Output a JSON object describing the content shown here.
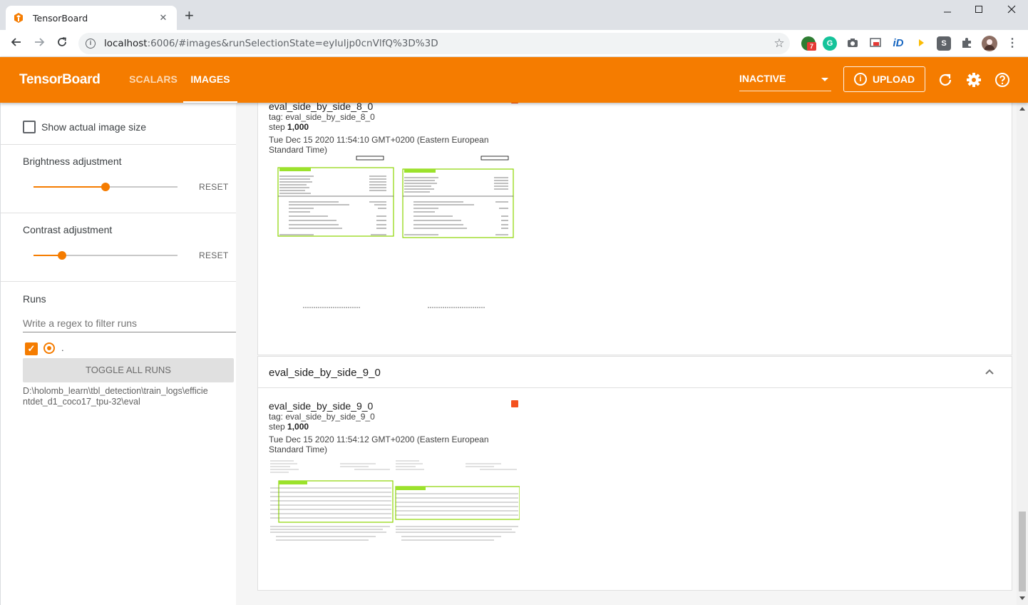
{
  "browser": {
    "tab_title": "TensorBoard",
    "close_glyph": "✕",
    "new_tab_glyph": "+",
    "url_host": "localhost",
    "url_rest": ":6006/#images&runSelectionState=eyIuIjp0cnVlfQ%3D%3D",
    "extension_badge": "7"
  },
  "header": {
    "brand": "TensorBoard",
    "tabs": [
      "SCALARS",
      "IMAGES"
    ],
    "active_tab": "IMAGES",
    "status_select": "INACTIVE",
    "upload_label": "UPLOAD",
    "accent_color": "#f57c00"
  },
  "sidebar": {
    "show_actual_size_label": "Show actual image size",
    "brightness_label": "Brightness adjustment",
    "brightness_level": 0.5,
    "contrast_label": "Contrast adjustment",
    "contrast_level": 0.2,
    "reset_label": "RESET",
    "runs_label": "Runs",
    "regex_placeholder": "Write a regex to filter runs",
    "run_name": ".",
    "toggle_all_label": "TOGGLE ALL RUNS",
    "logdir": "D:\\holomb_learn\\tbl_detection\\train_logs\\efficientdet_d1_coco17_tpu-32\\eval"
  },
  "cards": [
    {
      "image_name": "eval_side_by_side_8_0",
      "tag": "tag: eval_side_by_side_8_0",
      "step_label": "step",
      "step_value": "1,000",
      "date": "Tue Dec 15 2020 11:54:10 GMT+0200 (Eastern European Standard Time)"
    },
    {
      "title": "eval_side_by_side_9_0",
      "image_name": "eval_side_by_side_9_0",
      "tag": "tag: eval_side_by_side_9_0",
      "step_label": "step",
      "step_value": "1,000",
      "date": "Tue Dec 15 2020 11:54:12 GMT+0200 (Eastern European Standard Time)"
    }
  ]
}
